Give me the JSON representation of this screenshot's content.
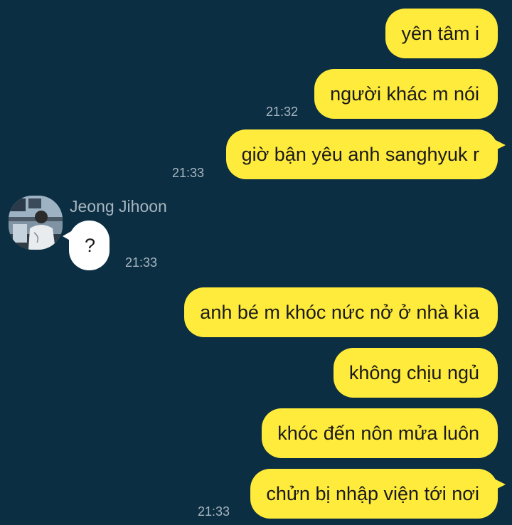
{
  "contact": {
    "name": "Jeong Jihoon"
  },
  "messages": [
    {
      "text": "yên tâm i"
    },
    {
      "text": "người khác m nói",
      "time": "21:32"
    },
    {
      "text": "giờ bận yêu anh sanghyuk r",
      "time": "21:33"
    },
    {
      "text": "?",
      "time": "21:33"
    },
    {
      "text": "anh bé m khóc nức nở ở nhà kìa"
    },
    {
      "text": "không chịu ngủ"
    },
    {
      "text": "khóc đến nôn mửa luôn"
    },
    {
      "text": "chửn bị nhập viện tới nơi",
      "time": "21:33"
    }
  ],
  "colors": {
    "background": "#0b2e42",
    "outgoing_bubble": "#ffeb3b",
    "incoming_bubble": "#ffffff",
    "meta_text": "#a7b6c0"
  },
  "icons": {
    "avatar": "profile-photo"
  }
}
